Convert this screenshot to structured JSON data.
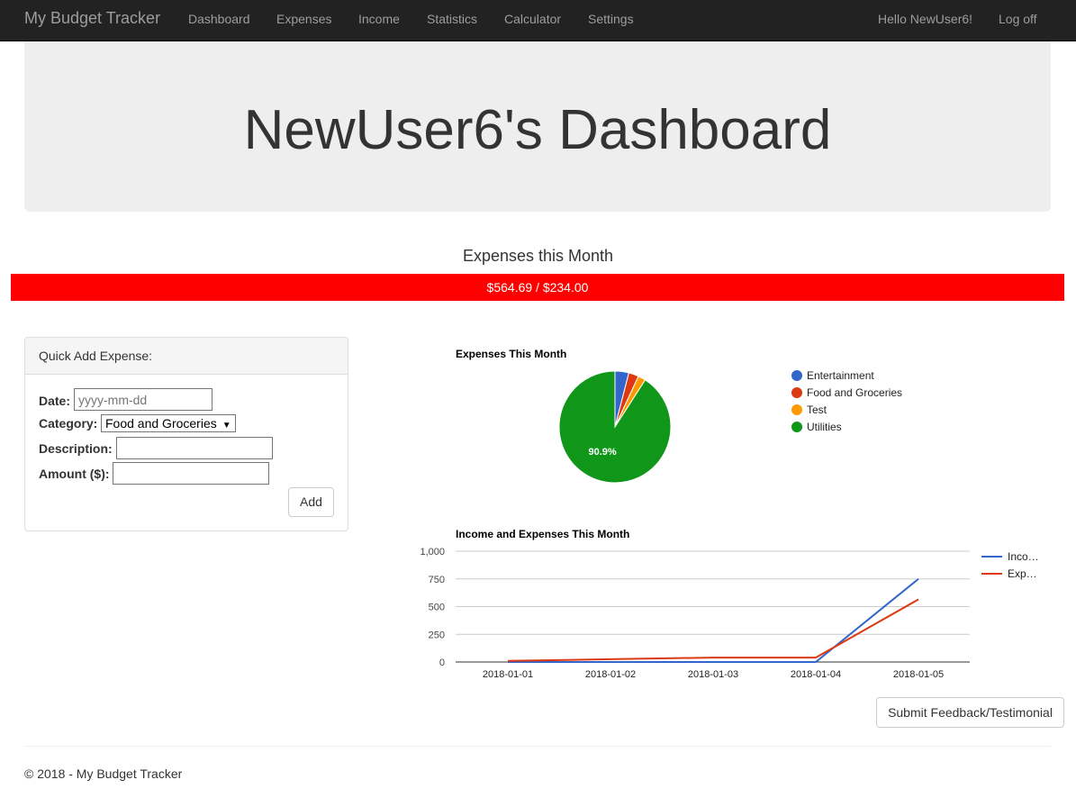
{
  "nav": {
    "brand": "My Budget Tracker",
    "links": [
      "Dashboard",
      "Expenses",
      "Income",
      "Statistics",
      "Calculator",
      "Settings"
    ],
    "greeting": "Hello NewUser6!",
    "logoff": "Log off"
  },
  "jumbotron": {
    "title": "NewUser6's Dashboard"
  },
  "expenses_month": {
    "title": "Expenses this Month",
    "bar_text": "$564.69 / $234.00",
    "bar_color": "#ff0000",
    "spent": 564.69,
    "budget": 234.0
  },
  "quick_add": {
    "heading": "Quick Add Expense:",
    "date_label": "Date:",
    "date_placeholder": "yyyy-mm-dd",
    "category_label": "Category:",
    "category_value": "Food and Groceries",
    "description_label": "Description:",
    "description_value": "",
    "amount_label": "Amount ($):",
    "amount_value": "",
    "add_button": "Add"
  },
  "feedback_button": "Submit Feedback/Testimonial",
  "footer": "© 2018 - My Budget Tracker",
  "chart_data": [
    {
      "type": "pie",
      "title": "Expenses This Month",
      "categories": [
        "Entertainment",
        "Food and Groceries",
        "Test",
        "Utilities"
      ],
      "values": [
        4.0,
        2.9,
        2.2,
        90.9
      ],
      "colors": [
        "#3366cc",
        "#dc3912",
        "#ff9900",
        "#109618"
      ],
      "slice_labels": [
        "",
        "",
        "",
        "90.9%"
      ],
      "legend": "right"
    },
    {
      "type": "line",
      "title": "Income and Expenses This Month",
      "x": [
        "2018-01-01",
        "2018-01-02",
        "2018-01-03",
        "2018-01-04",
        "2018-01-05"
      ],
      "series": [
        {
          "name": "Inco…",
          "values": [
            0,
            0,
            0,
            0,
            750
          ],
          "color": "#3366cc"
        },
        {
          "name": "Exp…",
          "values": [
            10,
            25,
            40,
            40,
            565
          ],
          "color": "#dc3912"
        }
      ],
      "yticks": [
        "0",
        "250",
        "500",
        "750",
        "1,000"
      ],
      "ylim": [
        0,
        1000
      ],
      "grid": true,
      "legend": "right"
    }
  ]
}
